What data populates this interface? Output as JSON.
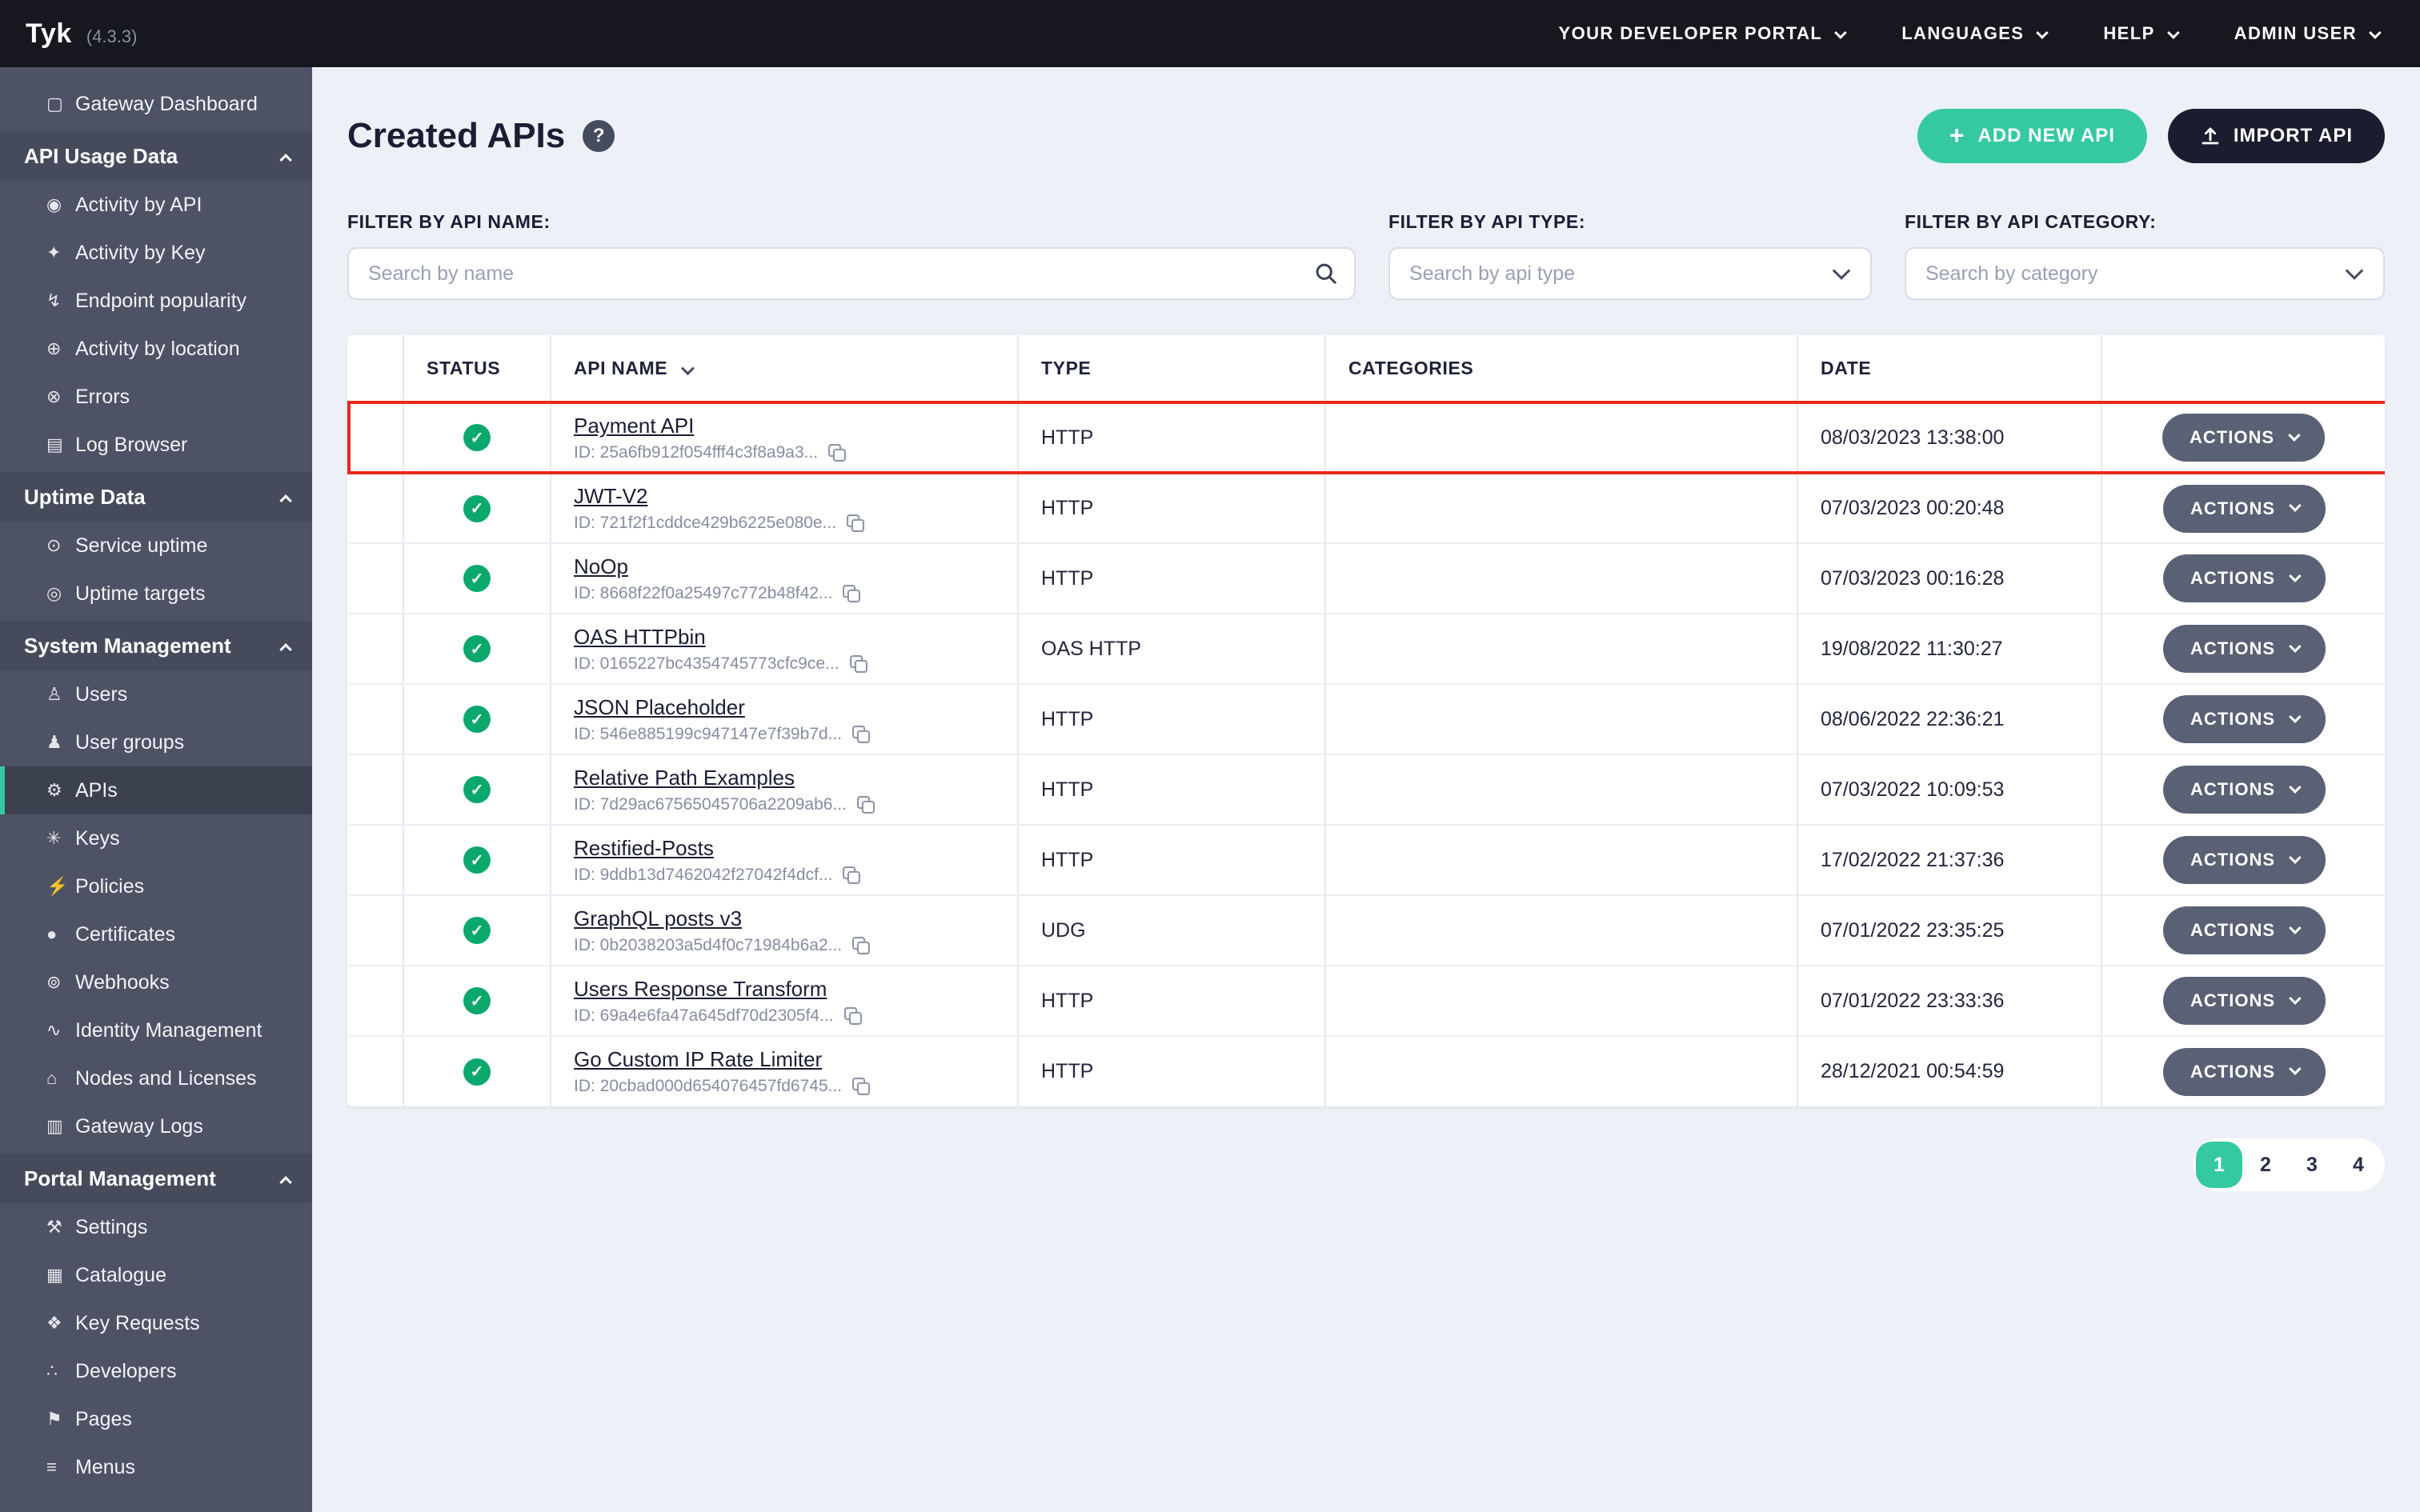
{
  "colors": {
    "accent_teal": "#35c9a2",
    "topbar_bg": "#16171f",
    "sidebar_bg": "#4d5365",
    "status_green": "#0ba86e",
    "highlight_red": "#e8291c",
    "page_bg": "#eef0f7"
  },
  "icons": {
    "help": "help-icon",
    "search": "search-icon",
    "select_chevron": "chevron-down-icon",
    "sort": "sort-chevron-down-icon",
    "copy": "copy-icon",
    "status_ok": "check-circle-icon",
    "plus": "plus-icon",
    "upload": "upload-icon",
    "menu_chevron": "chevron-down-icon",
    "section_chevron": "chevron-up-icon",
    "actions_chevron": "chevron-down-icon"
  },
  "topbar": {
    "logo": "Tyk",
    "version": "(4.3.3)",
    "menus": [
      {
        "label": "YOUR DEVELOPER PORTAL",
        "name": "menu-developer-portal"
      },
      {
        "label": "LANGUAGES",
        "name": "menu-languages"
      },
      {
        "label": "HELP",
        "name": "menu-help"
      },
      {
        "label": "ADMIN USER",
        "name": "menu-admin-user"
      }
    ]
  },
  "sidebar": {
    "items": [
      {
        "label": "Gateway Dashboard",
        "kind": "leaf top",
        "icon": "▢",
        "icon_name": "dashboard-icon",
        "name": "sidebar-item-gateway-dashboard"
      },
      {
        "label": "API Usage Data",
        "kind": "section",
        "chevron": true,
        "name": "sidebar-section-api-usage-data"
      },
      {
        "label": "Activity by API",
        "kind": "leaf",
        "icon": "◉",
        "icon_name": "activity-api-icon",
        "name": "sidebar-item-activity-by-api"
      },
      {
        "label": "Activity by Key",
        "kind": "leaf",
        "icon": "✦",
        "icon_name": "key-activity-icon",
        "name": "sidebar-item-activity-by-key"
      },
      {
        "label": "Endpoint popularity",
        "kind": "leaf",
        "icon": "↯",
        "icon_name": "endpoint-popularity-icon",
        "name": "sidebar-item-endpoint-popularity"
      },
      {
        "label": "Activity by location",
        "kind": "leaf",
        "icon": "⊕",
        "icon_name": "globe-icon",
        "name": "sidebar-item-activity-by-location"
      },
      {
        "label": "Errors",
        "kind": "leaf",
        "icon": "⊗",
        "icon_name": "errors-icon",
        "name": "sidebar-item-errors"
      },
      {
        "label": "Log Browser",
        "kind": "leaf",
        "icon": "▤",
        "icon_name": "log-browser-icon",
        "name": "sidebar-item-log-browser"
      },
      {
        "label": "Uptime Data",
        "kind": "section",
        "chevron": true,
        "name": "sidebar-section-uptime-data"
      },
      {
        "label": "Service uptime",
        "kind": "leaf",
        "icon": "⊙",
        "icon_name": "service-uptime-icon",
        "name": "sidebar-item-service-uptime"
      },
      {
        "label": "Uptime targets",
        "kind": "leaf",
        "icon": "◎",
        "icon_name": "uptime-targets-icon",
        "name": "sidebar-item-uptime-targets"
      },
      {
        "label": "System Management",
        "kind": "section",
        "chevron": true,
        "name": "sidebar-section-system-management"
      },
      {
        "label": "Users",
        "kind": "leaf",
        "icon": "♙",
        "icon_name": "user-icon",
        "name": "sidebar-item-users"
      },
      {
        "label": "User groups",
        "kind": "leaf",
        "icon": "♟",
        "icon_name": "user-group-icon",
        "name": "sidebar-item-user-groups"
      },
      {
        "label": "APIs",
        "kind": "leaf active",
        "icon": "⚙",
        "icon_name": "apis-icon",
        "name": "sidebar-item-apis"
      },
      {
        "label": "Keys",
        "kind": "leaf",
        "icon": "✳",
        "icon_name": "keys-icon",
        "name": "sidebar-item-keys"
      },
      {
        "label": "Policies",
        "kind": "leaf",
        "icon": "⚡",
        "icon_name": "policies-icon",
        "name": "sidebar-item-policies"
      },
      {
        "label": "Certificates",
        "kind": "leaf",
        "icon": "●",
        "icon_name": "certificates-icon",
        "name": "sidebar-item-certificates"
      },
      {
        "label": "Webhooks",
        "kind": "leaf",
        "icon": "⊚",
        "icon_name": "webhooks-icon",
        "name": "sidebar-item-webhooks"
      },
      {
        "label": "Identity Management",
        "kind": "leaf",
        "icon": "∿",
        "icon_name": "identity-icon",
        "name": "sidebar-item-identity-management"
      },
      {
        "label": "Nodes and Licenses",
        "kind": "leaf",
        "icon": "⌂",
        "icon_name": "nodes-licenses-icon",
        "name": "sidebar-item-nodes-and-licenses"
      },
      {
        "label": "Gateway Logs",
        "kind": "leaf",
        "icon": "▥",
        "icon_name": "gateway-logs-icon",
        "name": "sidebar-item-gateway-logs"
      },
      {
        "label": "Portal Management",
        "kind": "section",
        "chevron": true,
        "name": "sidebar-section-portal-management"
      },
      {
        "label": "Settings",
        "kind": "leaf",
        "icon": "⚒",
        "icon_name": "settings-wrench-icon",
        "name": "sidebar-item-settings"
      },
      {
        "label": "Catalogue",
        "kind": "leaf",
        "icon": "▦",
        "icon_name": "catalogue-icon",
        "name": "sidebar-item-catalogue"
      },
      {
        "label": "Key Requests",
        "kind": "leaf",
        "icon": "❖",
        "icon_name": "key-requests-icon",
        "name": "sidebar-item-key-requests"
      },
      {
        "label": "Developers",
        "kind": "leaf",
        "icon": "∴",
        "icon_name": "developers-icon",
        "name": "sidebar-item-developers"
      },
      {
        "label": "Pages",
        "kind": "leaf",
        "icon": "⚑",
        "icon_name": "pages-flag-icon",
        "name": "sidebar-item-pages"
      },
      {
        "label": "Menus",
        "kind": "leaf",
        "icon": "≡",
        "icon_name": "menus-icon",
        "name": "sidebar-item-menus"
      }
    ]
  },
  "main": {
    "title": "Created APIs",
    "buttons": {
      "add": "ADD NEW API",
      "import": "IMPORT API"
    },
    "filters": [
      {
        "label": "FILTER BY API NAME:",
        "placeholder": "Search by name",
        "search": true,
        "name": "filter-api-name"
      },
      {
        "label": "FILTER BY API TYPE:",
        "placeholder": "Search by api type",
        "select": true,
        "name": "filter-api-type"
      },
      {
        "label": "FILTER BY API CATEGORY:",
        "placeholder": "Search by category",
        "select": true,
        "name": "filter-api-category"
      }
    ],
    "table": {
      "headers": {
        "status": "STATUS",
        "name": "API NAME",
        "type": "TYPE",
        "categories": "CATEGORIES",
        "date": "DATE"
      },
      "actions_label": "ACTIONS",
      "rows": [
        {
          "name": "Payment API",
          "id": "ID: 25a6fb912f054fff4c3f8a9a3...",
          "type": "HTTP",
          "category": "",
          "date": "08/03/2023 13:38:00",
          "row_class": "highlighted"
        },
        {
          "name": "JWT-V2",
          "id": "ID: 721f2f1cddce429b6225e080e...",
          "type": "HTTP",
          "category": "",
          "date": "07/03/2023 00:20:48"
        },
        {
          "name": "NoOp",
          "id": "ID: 8668f22f0a25497c772b48f42...",
          "type": "HTTP",
          "category": "",
          "date": "07/03/2023 00:16:28"
        },
        {
          "name": "OAS HTTPbin",
          "id": "ID: 0165227bc4354745773cfc9ce...",
          "type": "OAS HTTP",
          "category": "",
          "date": "19/08/2022 11:30:27"
        },
        {
          "name": "JSON Placeholder",
          "id": "ID: 546e885199c947147e7f39b7d...",
          "type": "HTTP",
          "category": "",
          "date": "08/06/2022 22:36:21"
        },
        {
          "name": "Relative Path Examples",
          "id": "ID: 7d29ac67565045706a2209ab6...",
          "type": "HTTP",
          "category": "",
          "date": "07/03/2022 10:09:53"
        },
        {
          "name": "Restified-Posts",
          "id": "ID: 9ddb13d7462042f27042f4dcf...",
          "type": "HTTP",
          "category": "",
          "date": "17/02/2022 21:37:36"
        },
        {
          "name": "GraphQL posts v3",
          "id": "ID: 0b2038203a5d4f0c71984b6a2...",
          "type": "UDG",
          "category": "",
          "date": "07/01/2022 23:35:25"
        },
        {
          "name": "Users Response Transform",
          "id": "ID: 69a4e6fa47a645df70d2305f4...",
          "type": "HTTP",
          "category": "",
          "date": "07/01/2022 23:33:36"
        },
        {
          "name": "Go Custom IP Rate Limiter",
          "id": "ID: 20cbad000d654076457fd6745...",
          "type": "HTTP",
          "category": "",
          "date": "28/12/2021 00:54:59"
        }
      ]
    },
    "pagination": {
      "pages": [
        {
          "label": "1",
          "cls": "active"
        },
        {
          "label": "2"
        },
        {
          "label": "3"
        },
        {
          "label": "4"
        }
      ]
    }
  }
}
